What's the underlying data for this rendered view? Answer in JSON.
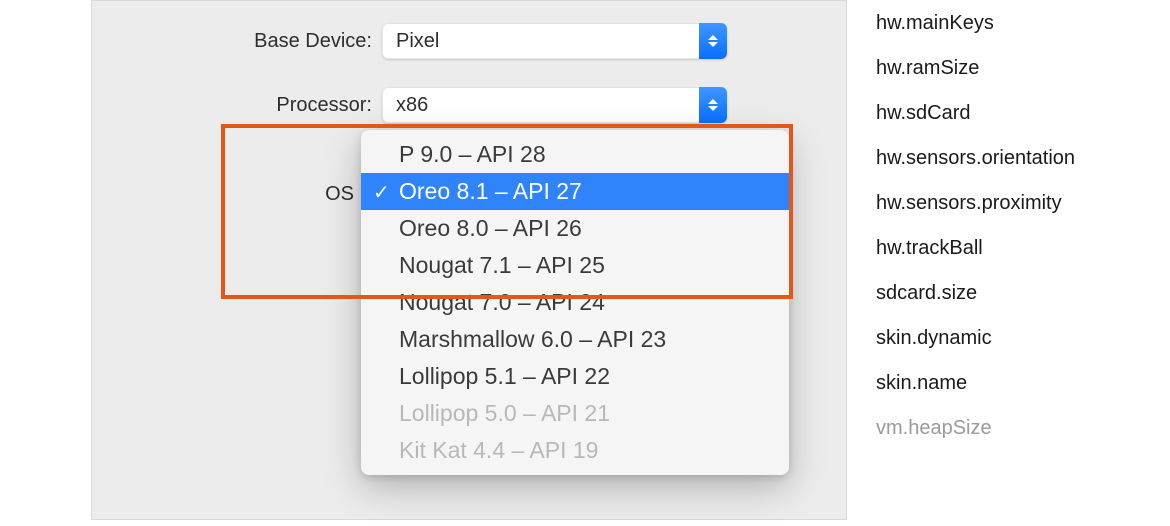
{
  "panel": {
    "baseDevice": {
      "label": "Base Device:",
      "value": "Pixel"
    },
    "processor": {
      "label": "Processor:",
      "value": "x86"
    },
    "os": {
      "label": "OS"
    }
  },
  "dropdown": {
    "selectedIndex": 1,
    "items": [
      {
        "label": "P 9.0 – API 28",
        "selected": false,
        "disabled": false
      },
      {
        "label": "Oreo 8.1 – API 27",
        "selected": true,
        "disabled": false
      },
      {
        "label": "Oreo 8.0 – API 26",
        "selected": false,
        "disabled": false
      },
      {
        "label": "Nougat 7.1 – API 25",
        "selected": false,
        "disabled": false
      },
      {
        "label": "Nougat 7.0 – API 24",
        "selected": false,
        "disabled": false
      },
      {
        "label": "Marshmallow 6.0 – API 23",
        "selected": false,
        "disabled": false
      },
      {
        "label": "Lollipop 5.1 – API 22",
        "selected": false,
        "disabled": false
      },
      {
        "label": "Lollipop 5.0 – API 21",
        "selected": false,
        "disabled": true
      },
      {
        "label": "Kit Kat 4.4 – API 19",
        "selected": false,
        "disabled": true
      }
    ]
  },
  "sideList": [
    {
      "label": "hw.mainKeys",
      "dim": false
    },
    {
      "label": "hw.ramSize",
      "dim": false
    },
    {
      "label": "hw.sdCard",
      "dim": false
    },
    {
      "label": "hw.sensors.orientation",
      "dim": false
    },
    {
      "label": "hw.sensors.proximity",
      "dim": false
    },
    {
      "label": "hw.trackBall",
      "dim": false
    },
    {
      "label": "sdcard.size",
      "dim": false
    },
    {
      "label": "skin.dynamic",
      "dim": false
    },
    {
      "label": "skin.name",
      "dim": false
    },
    {
      "label": "vm.heapSize",
      "dim": true
    }
  ]
}
